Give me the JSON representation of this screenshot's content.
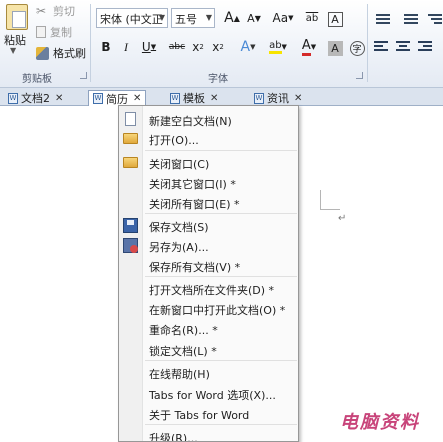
{
  "ribbon": {
    "clipboard": {
      "paste": "粘贴",
      "cut": "剪切",
      "copy": "复制",
      "format_painter": "格式刷",
      "group_label": "剪贴板"
    },
    "font": {
      "font_name": "宋体 (中文正",
      "font_size": "五号",
      "grow_font": "A",
      "shrink_font": "A",
      "change_case": "Aa",
      "phonetic": "ab",
      "char_border": "A",
      "bold": "B",
      "italic": "I",
      "underline": "U",
      "strikethrough": "abc",
      "subscript": "x",
      "superscript": "x",
      "text_effect": "A",
      "highlight": "ab",
      "font_color": "A",
      "char_shading": "A",
      "enclose": "字",
      "group_label": "字体"
    }
  },
  "tabs": [
    {
      "label": "文档2",
      "active": false
    },
    {
      "label": "简历",
      "active": true
    },
    {
      "label": "模板",
      "active": false
    },
    {
      "label": "资讯",
      "active": false
    }
  ],
  "menu": {
    "items": [
      {
        "label": "新建空白文档(N)",
        "icon": "new-document-icon"
      },
      {
        "label": "打开(O)...",
        "icon": "open-folder-icon"
      },
      {
        "label": "关闭窗口(C)",
        "icon": "close-window-icon"
      },
      {
        "label": "关闭其它窗口(I) *",
        "icon": ""
      },
      {
        "label": "关闭所有窗口(E) *",
        "icon": ""
      },
      {
        "label": "保存文档(S)",
        "icon": "save-icon"
      },
      {
        "label": "另存为(A)...",
        "icon": "save-as-icon"
      },
      {
        "label": "保存所有文档(V) *",
        "icon": ""
      },
      {
        "label": "打开文档所在文件夹(D) *",
        "icon": ""
      },
      {
        "label": "在新窗口中打开此文档(O) *",
        "icon": ""
      },
      {
        "label": "重命名(R)... *",
        "icon": ""
      },
      {
        "label": "锁定文档(L) *",
        "icon": ""
      },
      {
        "label": "在线帮助(H)",
        "icon": ""
      },
      {
        "label": "Tabs for Word 选项(X)...",
        "icon": ""
      },
      {
        "label": "关于 Tabs for Word",
        "icon": ""
      },
      {
        "label": "升级(R)...",
        "icon": ""
      }
    ]
  },
  "document": {
    "paragraph_mark": "↵"
  },
  "watermark": "电脑资料",
  "colors": {
    "highlight": "#f7e400",
    "font_color": "#d42a2a",
    "accent": "#3f6eaa"
  }
}
